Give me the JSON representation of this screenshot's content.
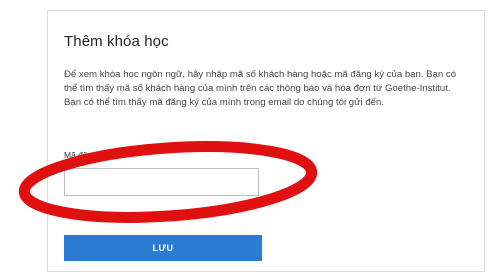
{
  "card": {
    "title": "Thêm khóa học",
    "description": "Để xem khóa học ngôn ngữ, hãy nhập mã số khách hàng hoặc mã đăng ký của bạn. Bạn có thể tìm thấy mã số khách hàng của mình trên các thông báo và hóa đơn từ Goethe-Institut. Bạn có thể tìm thấy mã đăng ký của mình trong email do chúng tôi gửi đến.",
    "field_label": "Mã đăng kí:",
    "field_value": "",
    "save_label": "LƯU"
  },
  "colors": {
    "button": "#2a7bd1",
    "annotation": "#e01010"
  }
}
